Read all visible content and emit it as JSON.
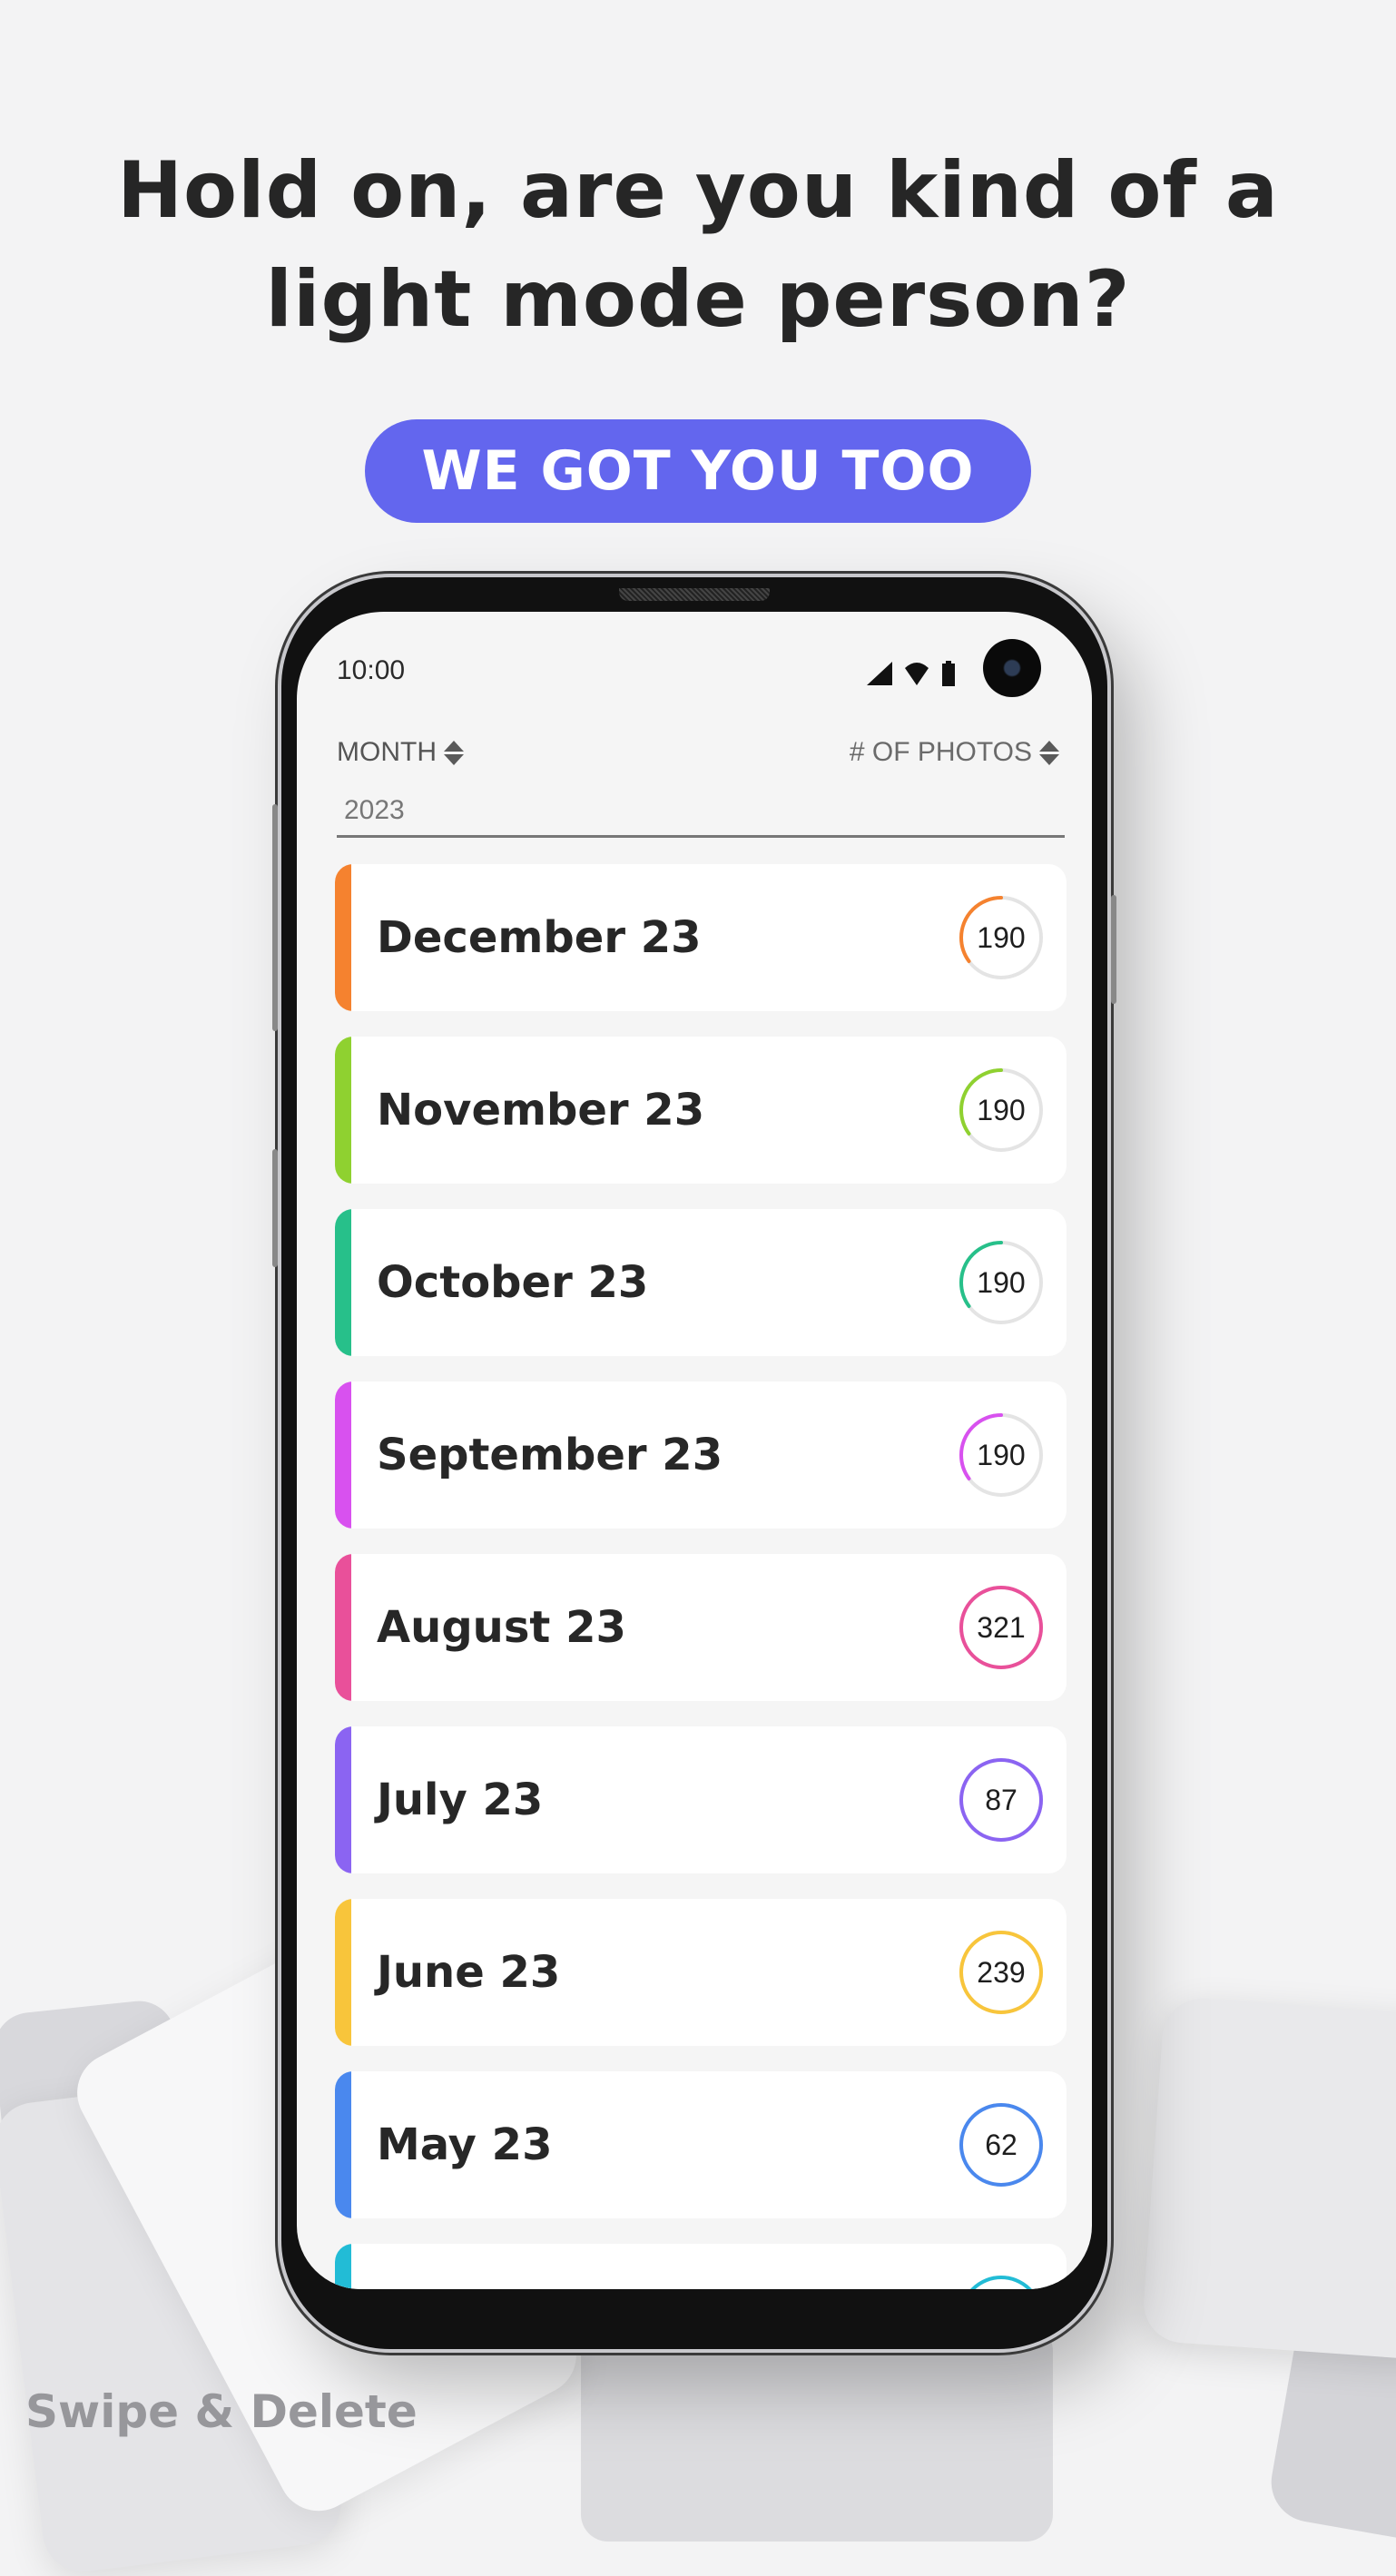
{
  "headline": {
    "line1": "Hold on, are you kind of a",
    "line2": "light mode person?"
  },
  "cta": {
    "label": "WE GOT YOU TOO",
    "color": "#6366ee"
  },
  "status_bar": {
    "time": "10:00",
    "icons": [
      "signal-icon",
      "wifi-icon",
      "battery-icon"
    ]
  },
  "table_header": {
    "left": {
      "label": "MONTH",
      "icon": "sort-icon"
    },
    "right": {
      "label": "# OF PHOTOS",
      "icon": "sort-icon"
    }
  },
  "year_filter": {
    "value": "2023"
  },
  "months": [
    {
      "label": "December 23",
      "count": "190",
      "color": "#f5822f",
      "progress": 0.35
    },
    {
      "label": "November 23",
      "count": "190",
      "color": "#8fd130",
      "progress": 0.35
    },
    {
      "label": "October 23",
      "count": "190",
      "color": "#27c08a",
      "progress": 0.35
    },
    {
      "label": "September 23",
      "count": "190",
      "color": "#d851ef",
      "progress": 0.35
    },
    {
      "label": "August 23",
      "count": "321",
      "color": "#e9509a",
      "progress": 1
    },
    {
      "label": "July 23",
      "count": "87",
      "color": "#8b64f2",
      "progress": 1
    },
    {
      "label": "June 23",
      "count": "239",
      "color": "#f8c53b",
      "progress": 1
    },
    {
      "label": "May 23",
      "count": "62",
      "color": "#4a88ee",
      "progress": 1
    },
    {
      "label": "",
      "count": "",
      "color": "#22bcd6",
      "progress": 1
    }
  ],
  "caption": "Swipe & Delete"
}
